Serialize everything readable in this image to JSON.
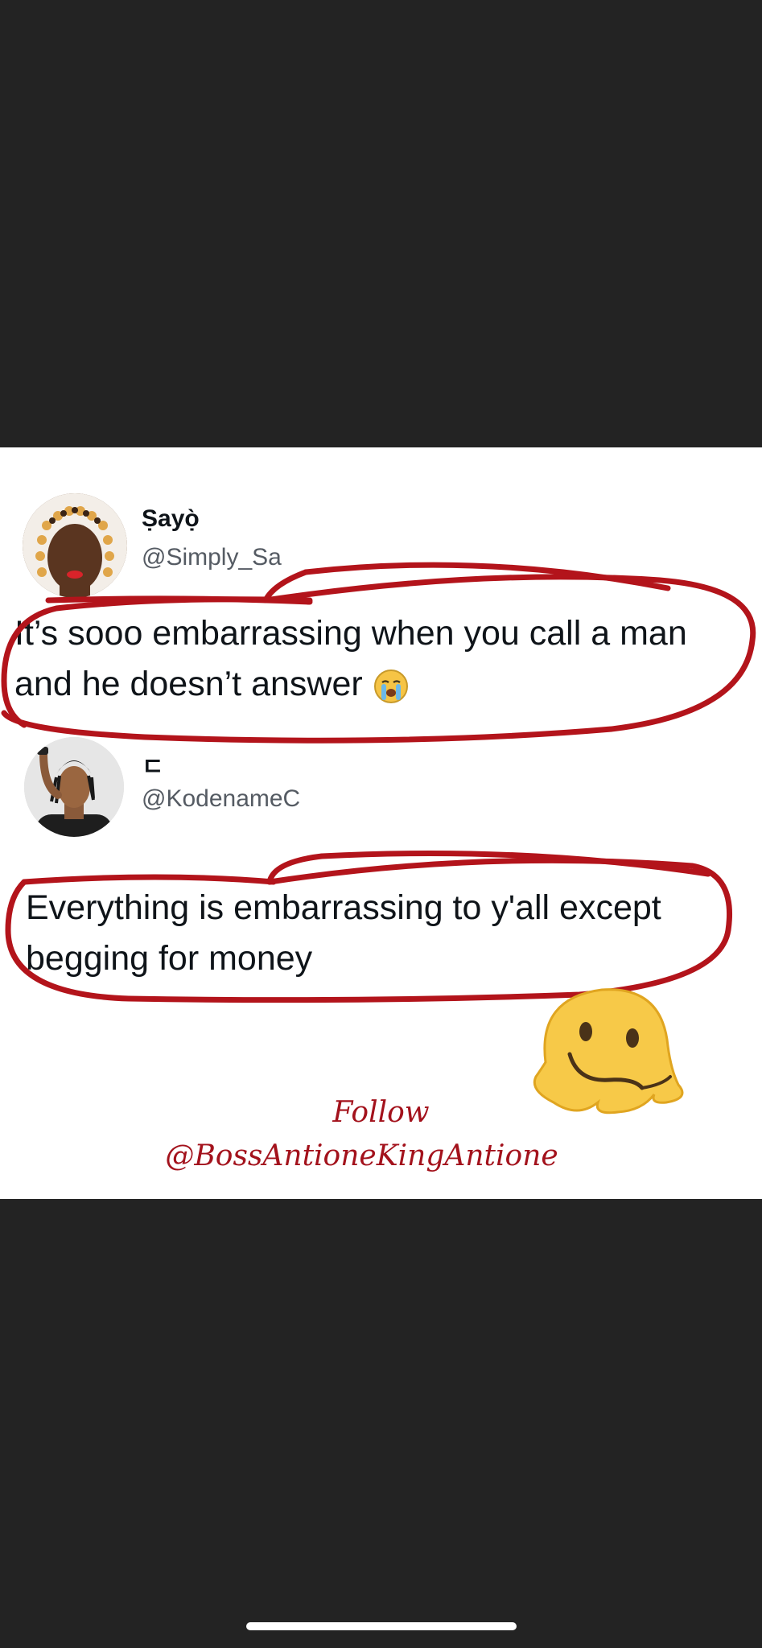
{
  "tweet1": {
    "name": "Ṣayọ̀",
    "handle": "@Simply_Sa",
    "text": "It’s sooo embarrassing when you call a man and he doesn’t answer",
    "emoji": "loudly-crying-face-icon"
  },
  "tweet2": {
    "name": "ㄷ",
    "handle": "@KodenameC",
    "text": "Everything is embarrassing to y'all except begging for money",
    "emoji": "melting-face-icon"
  },
  "watermark": {
    "line1": "Follow",
    "line2": "@BossAntioneKingAntione"
  },
  "colors": {
    "background": "#232323",
    "card": "#ffffff",
    "marker": "#b3141b",
    "watermark": "#a3121c"
  }
}
